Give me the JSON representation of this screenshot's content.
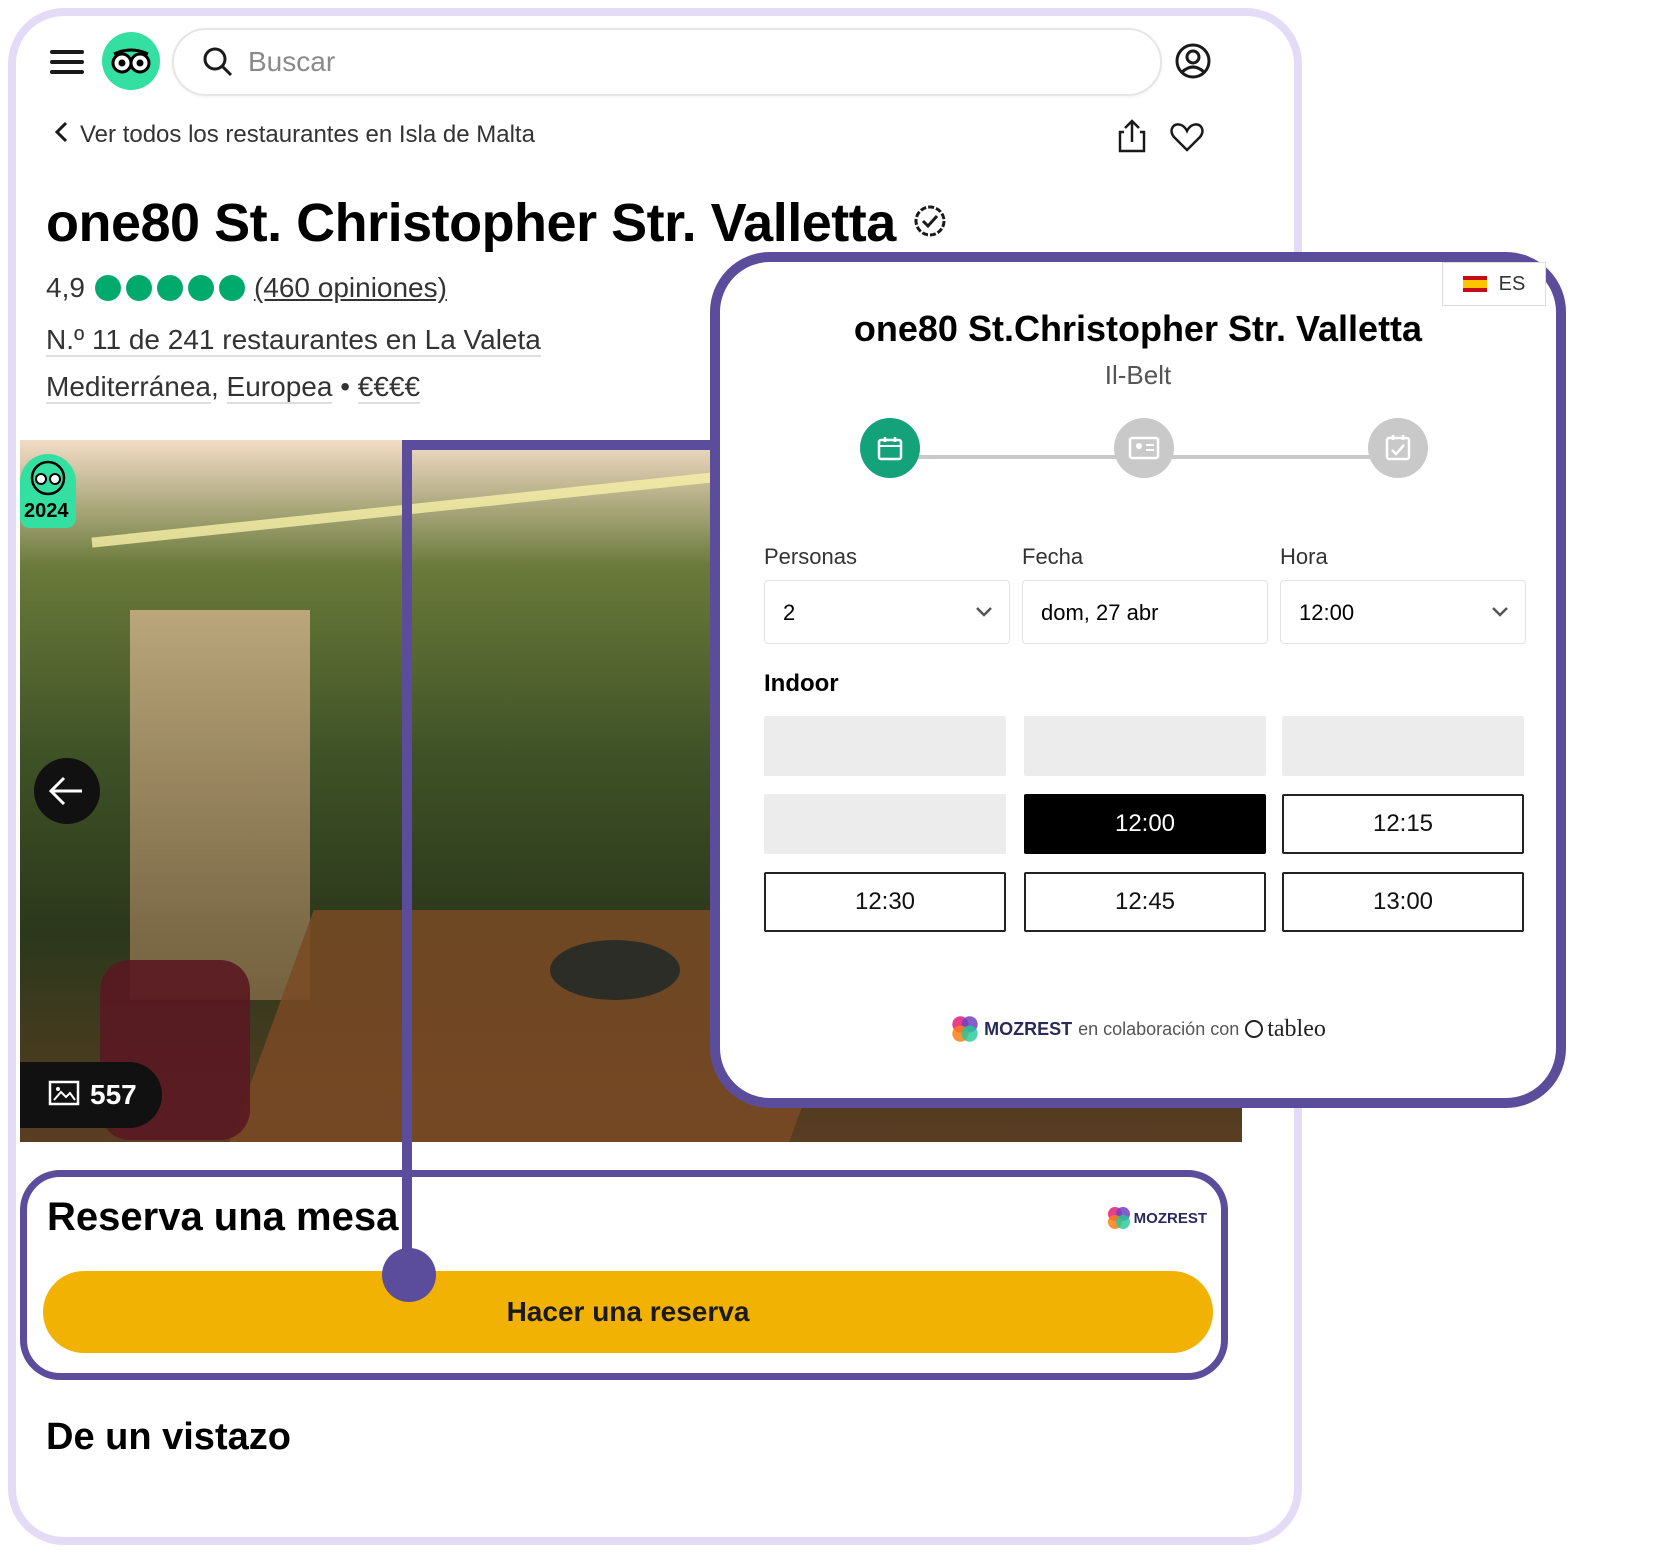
{
  "header": {
    "search_placeholder": "Buscar"
  },
  "nav": {
    "back_label": "Ver todos los restaurantes en Isla de Malta"
  },
  "restaurant": {
    "name": "one80 St. Christopher Str. Valletta",
    "rating": "4,9",
    "rating_value": 4.9,
    "rating_max": 5,
    "reviews": "(460 opiniones)",
    "rank": "N.º 11 de 241 restaurantes en La Valeta",
    "cuisine_1": "Mediterránea",
    "cuisine_2": "Europea",
    "price": "€€€€",
    "award_year": "2024",
    "photo_count": "557"
  },
  "reserve_section": {
    "heading": "Reserva una mesa",
    "provider": "MOZREST",
    "button_label": "Hacer una reserva"
  },
  "glance": {
    "heading": "De un vistazo"
  },
  "widget": {
    "language": "ES",
    "title": "one80 St.Christopher Str. Valletta",
    "subtitle": "Il-Belt",
    "labels": {
      "people": "Personas",
      "date": "Fecha",
      "time": "Hora"
    },
    "values": {
      "people": "2",
      "date": "dom, 27 abr",
      "time": "12:00"
    },
    "section": "Indoor",
    "slots": {
      "selected": "12:00",
      "s2": "12:15",
      "s3": "12:30",
      "s4": "12:45",
      "s5": "13:00"
    },
    "footer": {
      "brand": "MOZREST",
      "middle": "en colaboración con",
      "partner": "tableo"
    }
  },
  "colors": {
    "accent_purple": "#5c4c9c",
    "tripadvisor_green": "#34e0a1",
    "rating_green": "#00aa6c",
    "reserve_yellow": "#f2b203",
    "step_active": "#14a27a"
  }
}
